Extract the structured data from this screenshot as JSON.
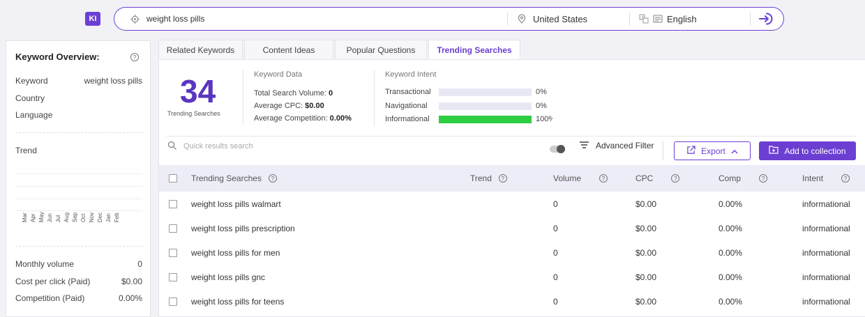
{
  "brand": {
    "logo_text": "KI",
    "accent": "#6c3fd2"
  },
  "search": {
    "query": "weight loss pills",
    "location": "United States",
    "language": "English"
  },
  "overview": {
    "title": "Keyword Overview:",
    "keyword_label": "Keyword",
    "keyword_value": "weight loss pills",
    "country_label": "Country",
    "language_label": "Language",
    "trend_label": "Trend",
    "months": [
      "Mar",
      "Apr",
      "May",
      "Jun",
      "Jul",
      "Aug",
      "Sep",
      "Oct",
      "Nov",
      "Dec",
      "Jan",
      "Feb"
    ],
    "monthly_volume_label": "Monthly volume",
    "monthly_volume_value": "0",
    "cpc_label": "Cost per click (Paid)",
    "cpc_value": "$0.00",
    "competition_label": "Competition (Paid)",
    "competition_value": "0.00%"
  },
  "tabs": [
    {
      "label": "Related Keywords",
      "active": false
    },
    {
      "label": "Content Ideas",
      "active": false
    },
    {
      "label": "Popular Questions",
      "active": false
    },
    {
      "label": "Trending Searches",
      "active": true
    }
  ],
  "summary": {
    "count": "34",
    "count_label": "Trending Searches",
    "keyword_data_title": "Keyword Data",
    "total_volume_label": "Total Search Volume:",
    "total_volume_value": "0",
    "avg_cpc_label": "Average CPC:",
    "avg_cpc_value": "$0.00",
    "avg_comp_label": "Average Competition:",
    "avg_comp_value": "0.00%",
    "intent_title": "Keyword Intent",
    "intents": [
      {
        "label": "Transactional",
        "pct": "0%",
        "fraction": 0
      },
      {
        "label": "Navigational",
        "pct": "0%",
        "fraction": 0
      },
      {
        "label": "Informational",
        "pct": "100%",
        "fraction": 1
      }
    ]
  },
  "toolbar": {
    "search_placeholder": "Quick results search",
    "advanced_filter": "Advanced Filter",
    "export": "Export",
    "add_to_collection": "Add to collection"
  },
  "table": {
    "headers": {
      "keyword": "Trending Searches",
      "trend": "Trend",
      "volume": "Volume",
      "cpc": "CPC",
      "comp": "Comp",
      "intent": "Intent"
    },
    "rows": [
      {
        "keyword": "weight loss pills walmart",
        "volume": "0",
        "cpc": "$0.00",
        "comp": "0.00%",
        "intent": "informational"
      },
      {
        "keyword": "weight loss pills prescription",
        "volume": "0",
        "cpc": "$0.00",
        "comp": "0.00%",
        "intent": "informational"
      },
      {
        "keyword": "weight loss pills for men",
        "volume": "0",
        "cpc": "$0.00",
        "comp": "0.00%",
        "intent": "informational"
      },
      {
        "keyword": "weight loss pills gnc",
        "volume": "0",
        "cpc": "$0.00",
        "comp": "0.00%",
        "intent": "informational"
      },
      {
        "keyword": "weight loss pills for teens",
        "volume": "0",
        "cpc": "$0.00",
        "comp": "0.00%",
        "intent": "informational"
      }
    ]
  }
}
